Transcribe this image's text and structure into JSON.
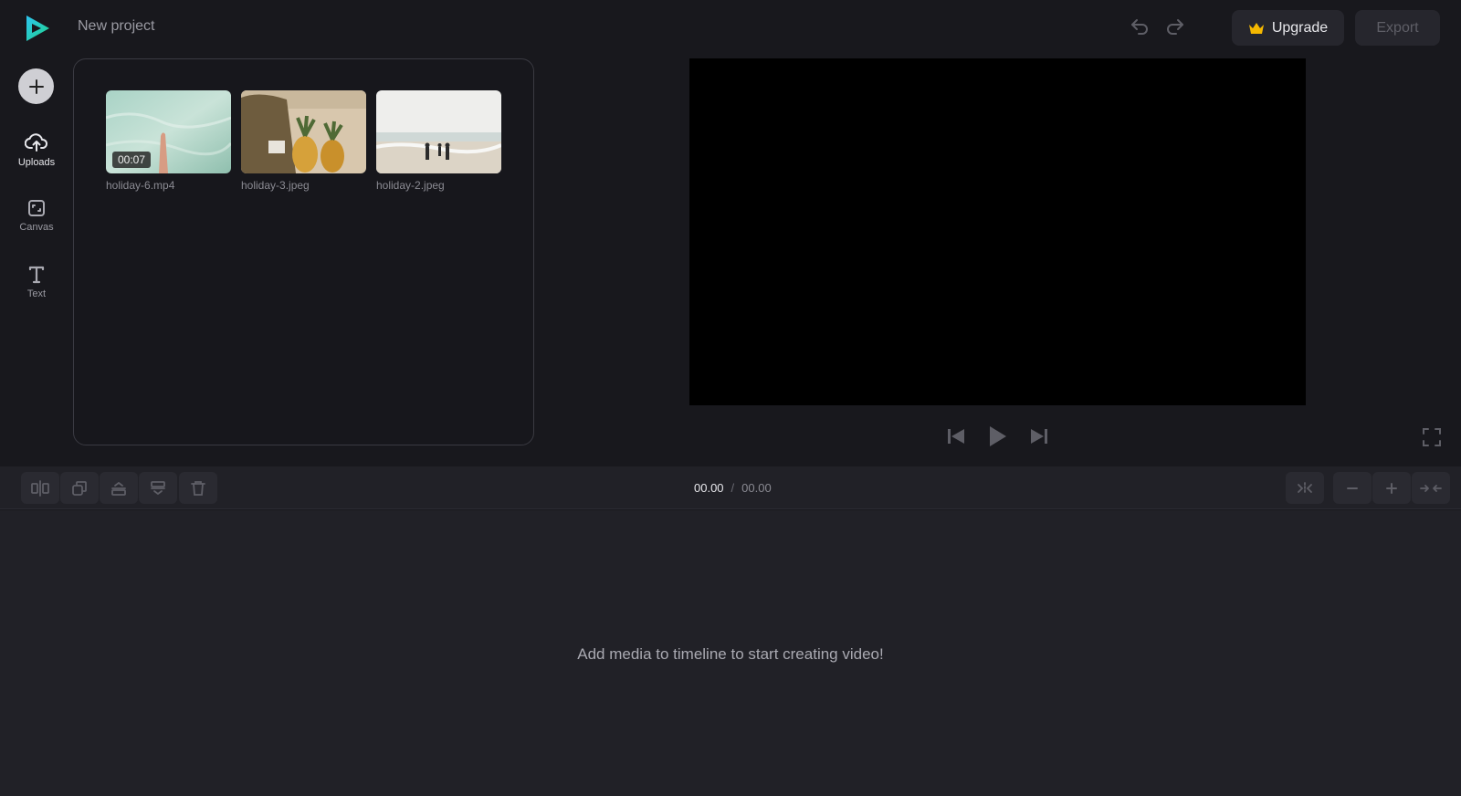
{
  "header": {
    "project_title": "New project",
    "upgrade_label": "Upgrade",
    "export_label": "Export"
  },
  "sidebar": {
    "items": [
      {
        "label": "Uploads",
        "icon": "upload-cloud-icon",
        "active": true
      },
      {
        "label": "Canvas",
        "icon": "canvas-resize-icon",
        "active": false
      },
      {
        "label": "Text",
        "icon": "text-icon",
        "active": false
      }
    ]
  },
  "uploads": {
    "media": [
      {
        "name": "holiday-6.mp4",
        "type": "video",
        "duration": "00:07"
      },
      {
        "name": "holiday-3.jpeg",
        "type": "image"
      },
      {
        "name": "holiday-2.jpeg",
        "type": "image"
      }
    ]
  },
  "toolbar": {
    "time_current": "00.00",
    "time_separator": "/",
    "time_total": "00.00"
  },
  "timeline": {
    "empty_message": "Add media to timeline to start creating video!"
  },
  "colors": {
    "background": "#18181d",
    "panel": "#212127",
    "accent_gradient": [
      "#2ec4f0",
      "#1fd38a"
    ],
    "crown": "#f5b800"
  }
}
